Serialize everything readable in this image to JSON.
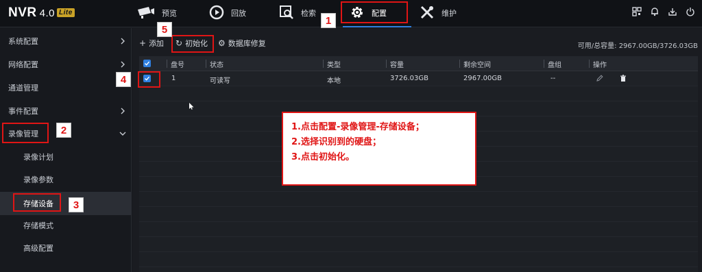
{
  "app": {
    "brand": "NVR",
    "version": "4.0",
    "edition": "Lite"
  },
  "nav": {
    "items": [
      {
        "label": "预览",
        "icon": "camera-icon"
      },
      {
        "label": "回放",
        "icon": "playback-icon"
      },
      {
        "label": "检索",
        "icon": "search-icon"
      },
      {
        "label": "配置",
        "icon": "gear-icon"
      },
      {
        "label": "维护",
        "icon": "wrench-icon"
      }
    ],
    "active": "配置"
  },
  "sidebar": {
    "items": [
      {
        "label": "系统配置",
        "expand": "collapsed"
      },
      {
        "label": "网络配置",
        "expand": "collapsed"
      },
      {
        "label": "通道管理",
        "expand": "none"
      },
      {
        "label": "事件配置",
        "expand": "collapsed"
      },
      {
        "label": "录像管理",
        "expand": "expanded"
      },
      {
        "label": "录像计划",
        "sub": true
      },
      {
        "label": "录像参数",
        "sub": true
      },
      {
        "label": "存储设备",
        "sub": true,
        "selected": true
      },
      {
        "label": "存储模式",
        "sub": true
      },
      {
        "label": "高级配置",
        "sub": true
      }
    ]
  },
  "toolbar": {
    "add_label": "添加",
    "init_label": "初始化",
    "repair_label": "数据库修复",
    "capacity": "可用/总容量: 2967.00GB/3726.03GB"
  },
  "table": {
    "headers": [
      "盘号",
      "状态",
      "类型",
      "容量",
      "剩余空间",
      "盘组",
      "操作"
    ],
    "rows": [
      {
        "disk_no": "1",
        "status": "可读写",
        "type": "本地",
        "capacity": "3726.03GB",
        "free": "2967.00GB",
        "group": "--",
        "checked": true
      }
    ]
  },
  "annotations": {
    "badges": [
      "1",
      "2",
      "3",
      "4",
      "5"
    ],
    "note": [
      "1.点击配置-录像管理-存储设备；",
      "2.选择识别到的硬盘；",
      "3.点击初始化。"
    ],
    "color": "#e01515"
  },
  "colors": {
    "accent": "#2f7fe0",
    "background": "#16181d",
    "logo_badge": "#c9a227"
  }
}
